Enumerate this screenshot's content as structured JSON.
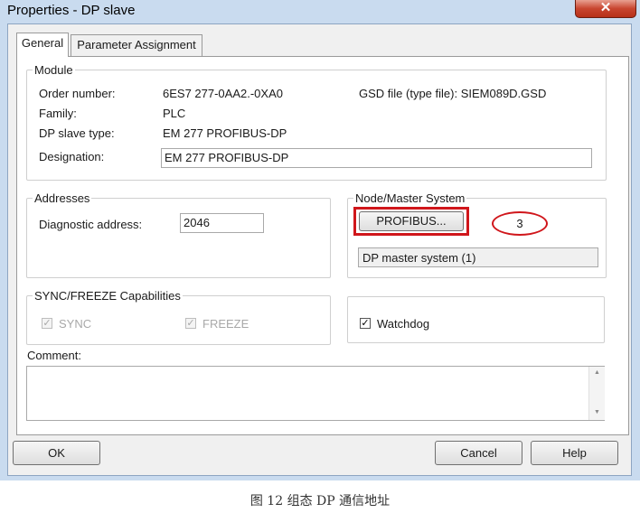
{
  "window": {
    "title": "Properties - DP slave",
    "close_symbol": "✕"
  },
  "tabs": [
    {
      "label": "General"
    },
    {
      "label": "Parameter Assignment"
    }
  ],
  "module": {
    "legend": "Module",
    "order_number_label": "Order number:",
    "order_number_value": "6ES7 277-0AA2.-0XA0",
    "gsd_file": "GSD file (type file): SIEM089D.GSD",
    "family_label": "Family:",
    "family_value": "PLC",
    "dp_slave_type_label": "DP slave type:",
    "dp_slave_type_value": "EM 277 PROFIBUS-DP",
    "designation_label": "Designation:",
    "designation_value": "EM 277 PROFIBUS-DP"
  },
  "addresses": {
    "legend": "Addresses",
    "diagnostic_label": "Diagnostic address:",
    "diagnostic_value": "2046"
  },
  "node_master": {
    "legend": "Node/Master System",
    "profibus_button": "PROFIBUS...",
    "annotation_number": "3",
    "master_system": "DP master system (1)"
  },
  "sync_freeze": {
    "legend": "SYNC/FREEZE Capabilities",
    "sync_label": "SYNC",
    "freeze_label": "FREEZE",
    "check_mark": "✓"
  },
  "watchdog": {
    "label": "Watchdog",
    "check_mark": "✓"
  },
  "comment": {
    "label": "Comment:",
    "value": ""
  },
  "buttons": {
    "ok": "OK",
    "cancel": "Cancel",
    "help": "Help"
  },
  "scroll": {
    "up": "▲",
    "down": "▼"
  },
  "annotation_color": "#d0161b",
  "caption": "图 12 组态 DP 通信地址"
}
